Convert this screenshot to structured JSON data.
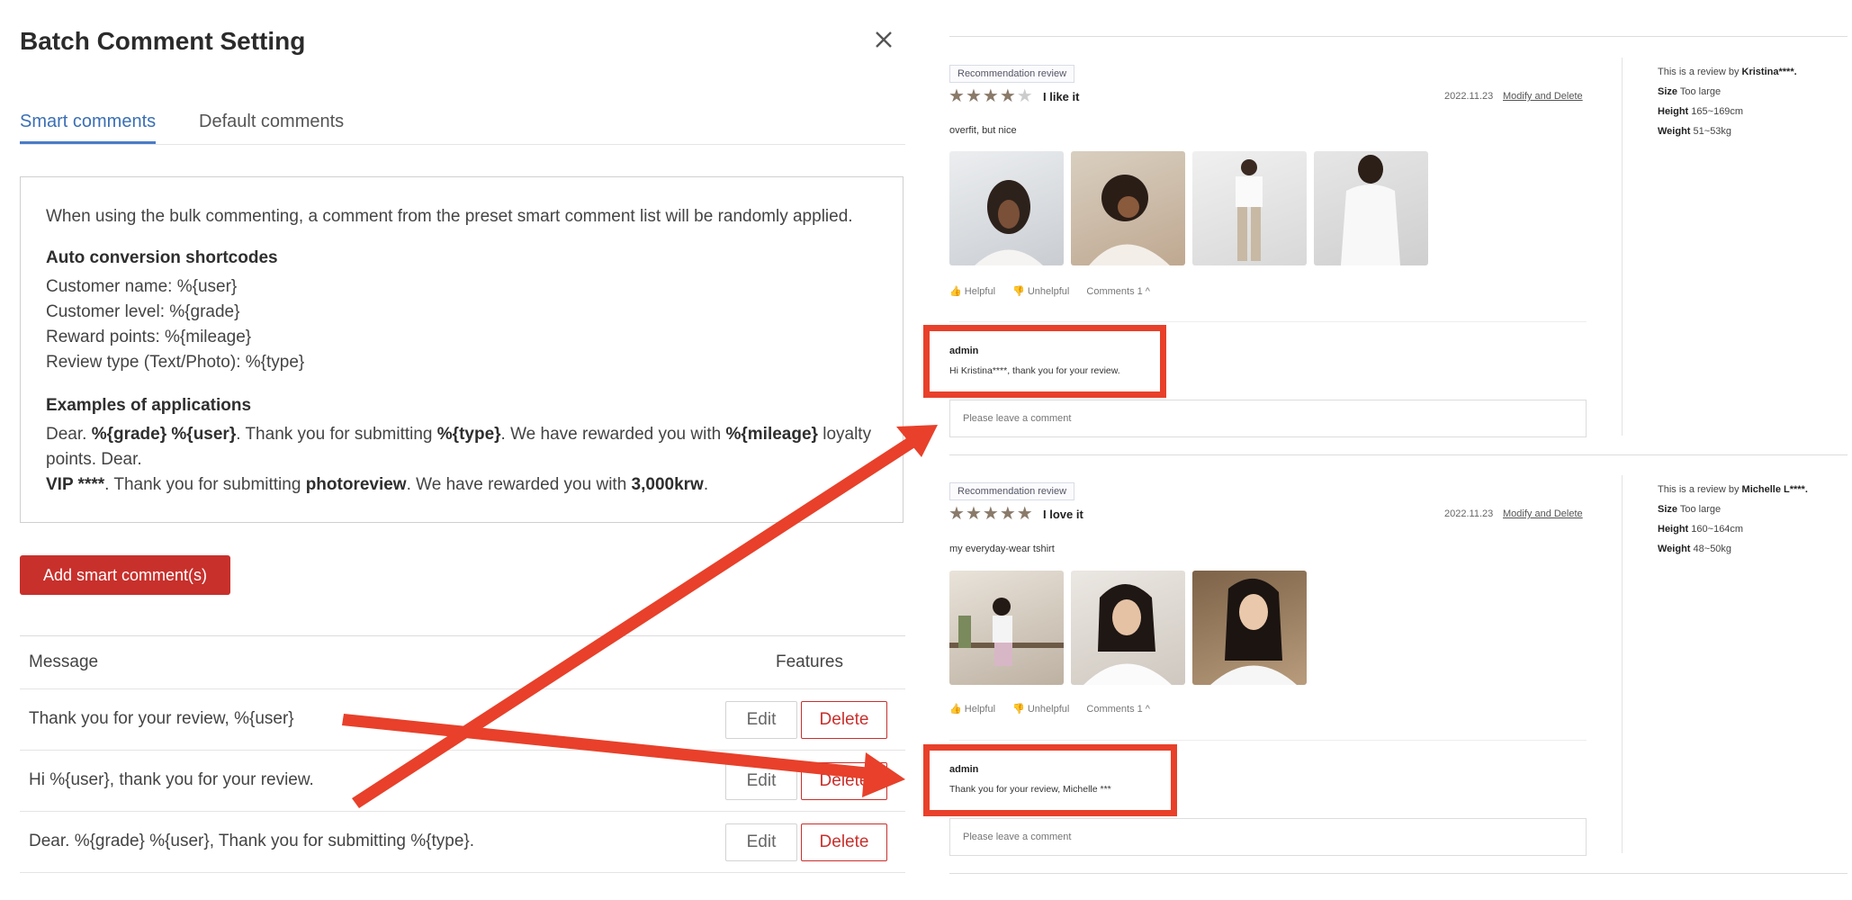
{
  "modal": {
    "title": "Batch Comment Setting",
    "tabs": [
      "Smart comments",
      "Default comments"
    ],
    "info": {
      "intro": "When using the bulk commenting, a comment from the preset smart comment list will be randomly applied.",
      "shortcodes_heading": "Auto conversion shortcodes",
      "shortcodes": [
        "Customer name: %{user}",
        "Customer level: %{grade}",
        "Reward points: %{mileage}",
        "Review type (Text/Photo): %{type}"
      ],
      "examples_heading": "Examples of applications",
      "ex1": {
        "a": "Dear. ",
        "b": "%{grade} %{user}",
        "c": ". Thank you for submitting ",
        "d": "%{type}",
        "e": ". We have rewarded you with ",
        "f": "%{mileage}",
        "g": " loyalty points. Dear."
      },
      "ex2": {
        "a": "VIP ****",
        "b": ". Thank you for submitting ",
        "c": "photoreview",
        "d": ". We have rewarded you with ",
        "e": "3,000krw",
        "f": "."
      }
    },
    "add_button": "Add smart comment(s)",
    "table": {
      "headers": [
        "Message",
        "Features"
      ],
      "rows": [
        "Thank you for your review, %{user}",
        "Hi %{user}, thank you for your review.",
        "Dear. %{grade} %{user}, Thank you for submitting %{type}."
      ],
      "edit_label": "Edit",
      "delete_label": "Delete"
    }
  },
  "reviews": [
    {
      "badge": "Recommendation review",
      "rating": 4,
      "title": "I like it",
      "date": "2022.11.23",
      "modify_label": "Modify and Delete",
      "body": "overfit, but nice",
      "photo_count": 4,
      "actions": [
        "Helpful",
        "Unhelpful",
        "Comments 1 ^"
      ],
      "admin_name": "admin",
      "admin_comment": "Hi Kristina****, thank you for your review.",
      "input_placeholder": "Please leave a comment",
      "side": {
        "by_prefix": "This is a review by ",
        "by_name": "Kristina****.",
        "size_label": "Size",
        "size": "Too large",
        "height_label": "Height",
        "height": "165~169cm",
        "weight_label": "Weight",
        "weight": "51~53kg"
      }
    },
    {
      "badge": "Recommendation review",
      "rating": 5,
      "title": "I love it",
      "date": "2022.11.23",
      "modify_label": "Modify and Delete",
      "body": "my everyday-wear tshirt",
      "photo_count": 3,
      "actions": [
        "Helpful",
        "Unhelpful",
        "Comments 1 ^"
      ],
      "admin_name": "admin",
      "admin_comment": "Thank you for your review, Michelle ***",
      "input_placeholder": "Please leave a comment",
      "side": {
        "by_prefix": "This is a review by ",
        "by_name": "Michelle L****.",
        "size_label": "Size",
        "size": "Too large",
        "height_label": "Height",
        "height": "160~164cm",
        "weight_label": "Weight",
        "weight": "48~50kg"
      }
    }
  ],
  "colors": {
    "accent_red": "#c8302c",
    "annotation_red": "#e8402a",
    "tab_blue": "#4a7cc7",
    "star": "#8a7a6a"
  }
}
